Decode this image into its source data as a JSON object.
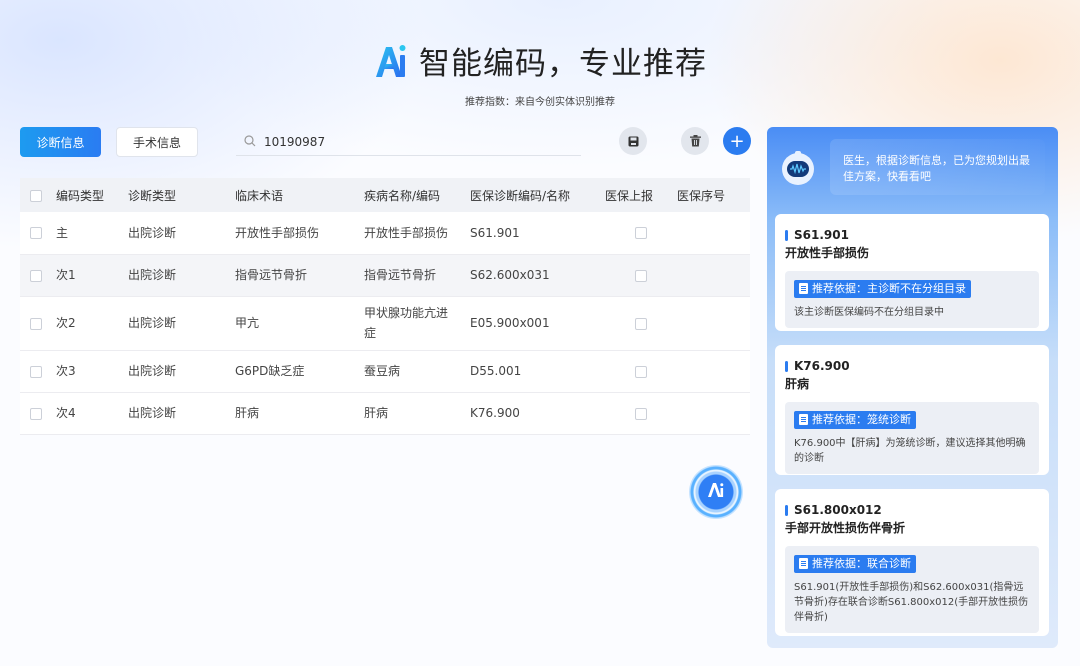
{
  "header": {
    "title": "智能编码，专业推荐",
    "subtitle": "推荐指数：来自今创实体识别推荐"
  },
  "toolbar": {
    "tab_diagnosis": "诊断信息",
    "tab_surgery": "手术信息",
    "search_value": "10190987",
    "save_icon": "save-icon",
    "delete_icon": "trash-icon",
    "add_label": "+"
  },
  "table": {
    "columns": [
      "编码类型",
      "诊断类型",
      "临床术语",
      "疾病名称/编码",
      "医保诊断编码/名称",
      "医保上报",
      "医保序号"
    ],
    "rows": [
      {
        "code_type": "主",
        "diag_type": "出院诊断",
        "term": "开放性手部损伤",
        "disease": "开放性手部损伤",
        "insurance_code": "S61.901"
      },
      {
        "code_type": "次1",
        "diag_type": "出院诊断",
        "term": "指骨远节骨折",
        "disease": "指骨远节骨折",
        "insurance_code": "S62.600x031"
      },
      {
        "code_type": "次2",
        "diag_type": "出院诊断",
        "term": "甲亢",
        "disease": "甲状腺功能亢进症",
        "insurance_code": "E05.900x001"
      },
      {
        "code_type": "次3",
        "diag_type": "出院诊断",
        "term": "G6PD缺乏症",
        "disease": "蚕豆病",
        "insurance_code": "D55.001"
      },
      {
        "code_type": "次4",
        "diag_type": "出院诊断",
        "term": "肝病",
        "disease": "肝病",
        "insurance_code": "K76.900"
      }
    ]
  },
  "panel": {
    "message": "医生，根据诊断信息，已为您规划出最佳方案，快看看吧",
    "cards": [
      {
        "code": "S61.901",
        "name": "开放性手部损伤",
        "basis_label": "推荐依据：主诊断不在分组目录",
        "basis_text": "该主诊断医保编码不在分组目录中"
      },
      {
        "code": "K76.900",
        "name": "肝病",
        "basis_label": "推荐依据：笼统诊断",
        "basis_text": "K76.900中【肝病】为笼统诊断，建议选择其他明确的诊断"
      },
      {
        "code": "S61.800x012",
        "name": "手部开放性损伤伴骨折",
        "basis_label": "推荐依据：联合诊断",
        "basis_text": "S61.901(开放性手部损伤)和S62.600x031(指骨远节骨折)存在联合诊断S61.800x012(手部开放性损伤伴骨折)"
      }
    ]
  },
  "colors": {
    "accent": "#2b7cf0",
    "tab_active": "#1d9bf0"
  }
}
